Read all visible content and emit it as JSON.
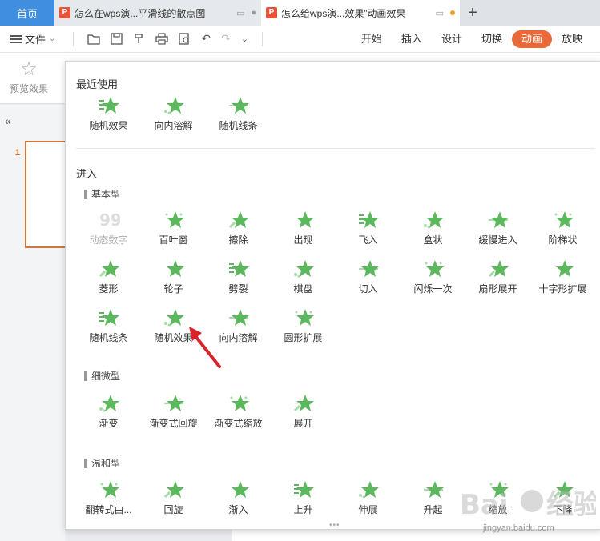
{
  "tabs": {
    "home": "首页",
    "doc1": "怎么在wps演...平滑线的散点图",
    "doc2": "怎么给wps演...效果”动画效果"
  },
  "toolbar": {
    "file_label": "文件",
    "ribbon_tabs": [
      "开始",
      "插入",
      "设计",
      "切换",
      "动画",
      "放映"
    ],
    "active_tab": "动画"
  },
  "ribbon": {
    "preview_label": "预览效果"
  },
  "left_panel": {
    "slide_number": "1"
  },
  "panel": {
    "recent_title": "最近使用",
    "recent": [
      "随机效果",
      "向内溶解",
      "随机线条"
    ],
    "enter_title": "进入",
    "basic_title": "基本型",
    "basic": [
      "动态数字",
      "百叶窗",
      "擦除",
      "出现",
      "飞入",
      "盒状",
      "缓慢进入",
      "阶梯状",
      "菱形",
      "轮子",
      "劈裂",
      "棋盘",
      "切入",
      "闪烁一次",
      "扇形展开",
      "十字形扩展",
      "随机线条",
      "随机效果",
      "向内溶解",
      "圆形扩展"
    ],
    "subtle_title": "细微型",
    "subtle": [
      "渐变",
      "渐变式回旋",
      "渐变式缩放",
      "展开"
    ],
    "moderate_title": "温和型",
    "moderate": [
      "翻转式由...",
      "回旋",
      "渐入",
      "上升",
      "伸展",
      "升起",
      "缩放",
      "下降"
    ]
  },
  "watermark": {
    "text": "jingyan.baidu.com"
  },
  "colors": {
    "accent": "#e8693a",
    "home_tab": "#3f8ee0",
    "icon_green": "#5cb85c",
    "arrow": "#d9232a"
  }
}
